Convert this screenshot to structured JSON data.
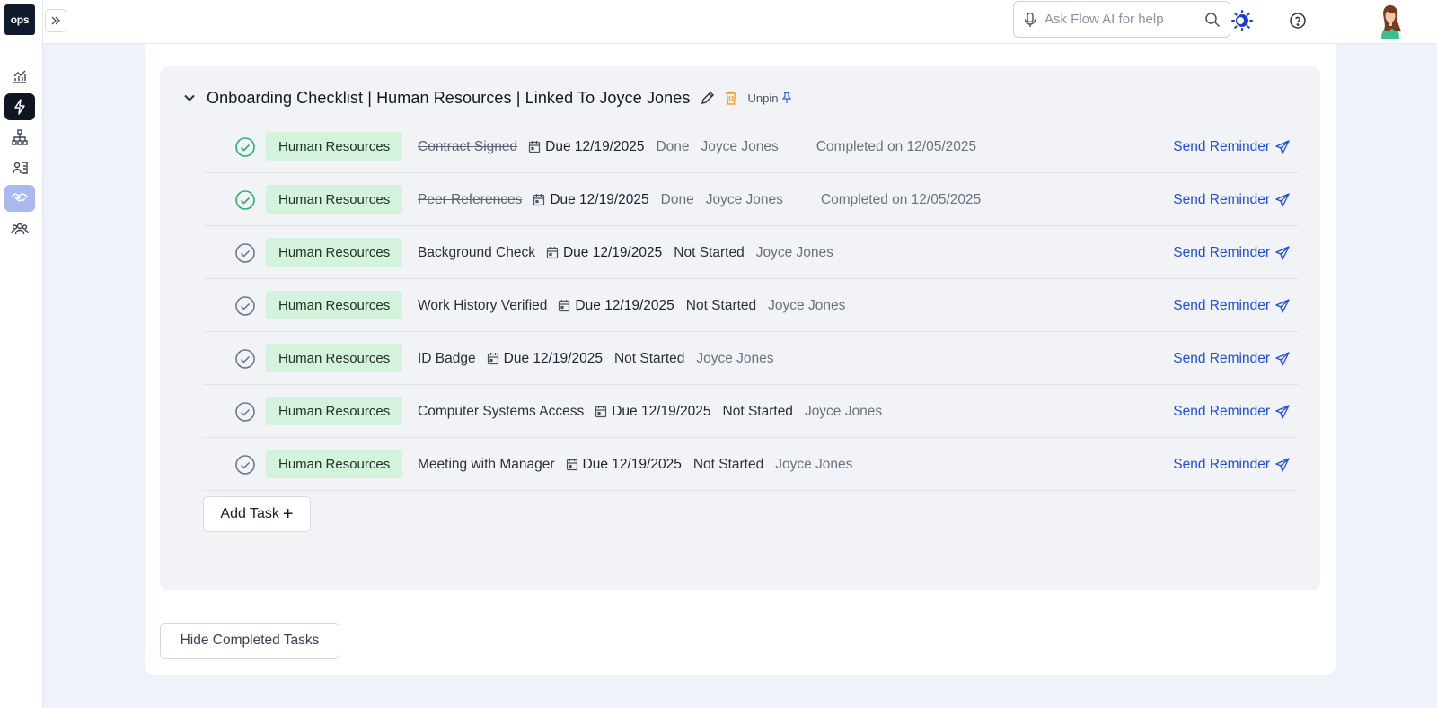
{
  "app": {
    "logo_text": "ops"
  },
  "search": {
    "placeholder": "Ask Flow AI for help"
  },
  "checklist": {
    "title": "Onboarding Checklist | Human Resources | Linked To Joyce Jones",
    "unpin_label": "Unpin",
    "tasks": [
      {
        "tag": "Human Resources",
        "name": "Contract Signed",
        "due": "Due 12/19/2025",
        "status": "Done",
        "assignee": "Joyce Jones",
        "completed": "Completed on 12/05/2025",
        "reminder": "Send Reminder",
        "done": true
      },
      {
        "tag": "Human Resources",
        "name": "Peer References",
        "due": "Due 12/19/2025",
        "status": "Done",
        "assignee": "Joyce Jones",
        "completed": "Completed on 12/05/2025",
        "reminder": "Send Reminder",
        "done": true
      },
      {
        "tag": "Human Resources",
        "name": "Background Check",
        "due": "Due 12/19/2025",
        "status": "Not Started",
        "assignee": "Joyce Jones",
        "completed": "",
        "reminder": "Send Reminder",
        "done": false
      },
      {
        "tag": "Human Resources",
        "name": "Work History Verified",
        "due": "Due 12/19/2025",
        "status": "Not Started",
        "assignee": "Joyce Jones",
        "completed": "",
        "reminder": "Send Reminder",
        "done": false
      },
      {
        "tag": "Human Resources",
        "name": "ID Badge",
        "due": "Due 12/19/2025",
        "status": "Not Started",
        "assignee": "Joyce Jones",
        "completed": "",
        "reminder": "Send Reminder",
        "done": false
      },
      {
        "tag": "Human Resources",
        "name": "Computer Systems Access",
        "due": "Due 12/19/2025",
        "status": "Not Started",
        "assignee": "Joyce Jones",
        "completed": "",
        "reminder": "Send Reminder",
        "done": false
      },
      {
        "tag": "Human Resources",
        "name": "Meeting with Manager",
        "due": "Due 12/19/2025",
        "status": "Not Started",
        "assignee": "Joyce Jones",
        "completed": "",
        "reminder": "Send Reminder",
        "done": false
      }
    ],
    "add_task_label": "Add Task",
    "hide_completed_label": "Hide Completed Tasks"
  },
  "colors": {
    "accent": "#1f4fd8",
    "tag_bg": "#d3f3dc",
    "done_check": "#27b36a",
    "pending_check": "#6b7280",
    "trash": "#f0a020"
  },
  "icons": [
    "expand-icon",
    "analytics-icon",
    "lightning-icon",
    "org-chart-icon",
    "id-card-icon",
    "handshake-icon",
    "team-icon",
    "microphone-icon",
    "search-icon",
    "flow-ai-icon",
    "help-icon",
    "chevron-down-icon",
    "pencil-icon",
    "trash-icon",
    "pin-icon",
    "calendar-icon",
    "send-icon",
    "check-circle-icon"
  ]
}
